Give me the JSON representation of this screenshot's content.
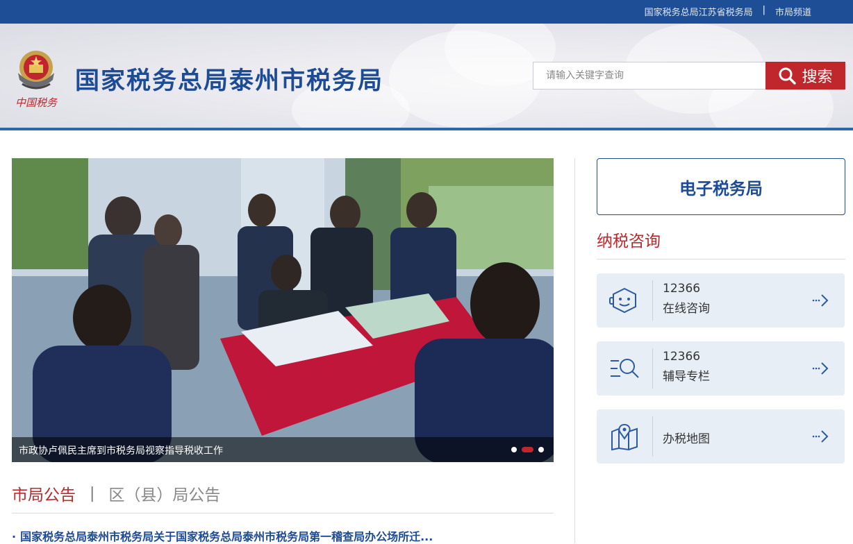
{
  "topbar": {
    "link_province": "国家税务总局江苏省税务局",
    "separator": "|",
    "link_channel": "市局频道"
  },
  "header": {
    "emblem_icon": "tax-emblem-icon",
    "emblem_script": "中国税务",
    "site_title": "国家税务总局泰州市税务局"
  },
  "search": {
    "placeholder": "请输入关键字查询",
    "button_label": "搜索",
    "button_icon": "search-icon"
  },
  "slider": {
    "caption": "市政协卢佩民主席到市税务局视察指导税收工作",
    "dot_count": 3,
    "active_dot": 2
  },
  "notices": {
    "tab_city": "市局公告",
    "tab_separator": "|",
    "tab_district": "区（县）局公告",
    "items": [
      "国家税务总局泰州市税务局关于国家税务总局泰州市税务局第一稽查局办公场所迁..."
    ]
  },
  "sidebar": {
    "etax_label": "电子税务局",
    "consult_title": "纳税咨询",
    "services": [
      {
        "line1": "12366",
        "line2": "在线咨询",
        "icon": "chat-bot-icon"
      },
      {
        "line1": "12366",
        "line2": "辅导专栏",
        "icon": "search-list-icon"
      },
      {
        "label": "办税地图",
        "icon": "map-pin-icon"
      }
    ],
    "arrow_icon": "arrow-right-icon"
  },
  "colors": {
    "brand_blue": "#1d4c94",
    "topbar_blue": "#1e4f96",
    "accent_red": "#c0272d",
    "card_bg": "#e7eef6"
  }
}
